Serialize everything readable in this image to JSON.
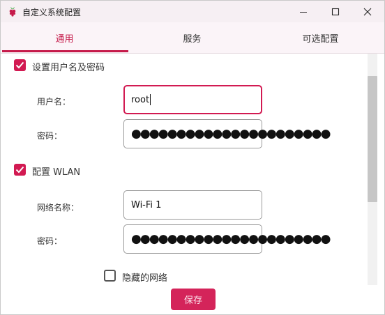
{
  "window": {
    "title": "自定义系统配置",
    "icon": "raspberry-icon",
    "controls": [
      "minimize-icon",
      "maximize-icon",
      "close-icon"
    ]
  },
  "tabs": [
    {
      "label": "通用",
      "active": true
    },
    {
      "label": "服务",
      "active": false
    },
    {
      "label": "可选配置",
      "active": false
    }
  ],
  "general": {
    "set_user": {
      "label": "设置用户名及密码",
      "checked": true
    },
    "username": {
      "label": "用户名：",
      "value": "root"
    },
    "user_password": {
      "label": "密码：",
      "value": "●●●●●●●●●●●●●●●●●●●●●●"
    },
    "wlan": {
      "label": "配置 WLAN",
      "checked": true
    },
    "ssid": {
      "label": "网络名称：",
      "value": "Wi-Fi 1"
    },
    "wlan_password": {
      "label": "密码：",
      "value": "●●●●●●●●●●●●●●●●●●●●●●"
    },
    "hidden_network": {
      "label": "隐藏的网络",
      "checked": false
    }
  },
  "actions": {
    "save_label": "保存"
  },
  "colors": {
    "accent": "#d21a52",
    "tab_bg": "#fbf4f8",
    "title_bg": "#f6eff3"
  }
}
